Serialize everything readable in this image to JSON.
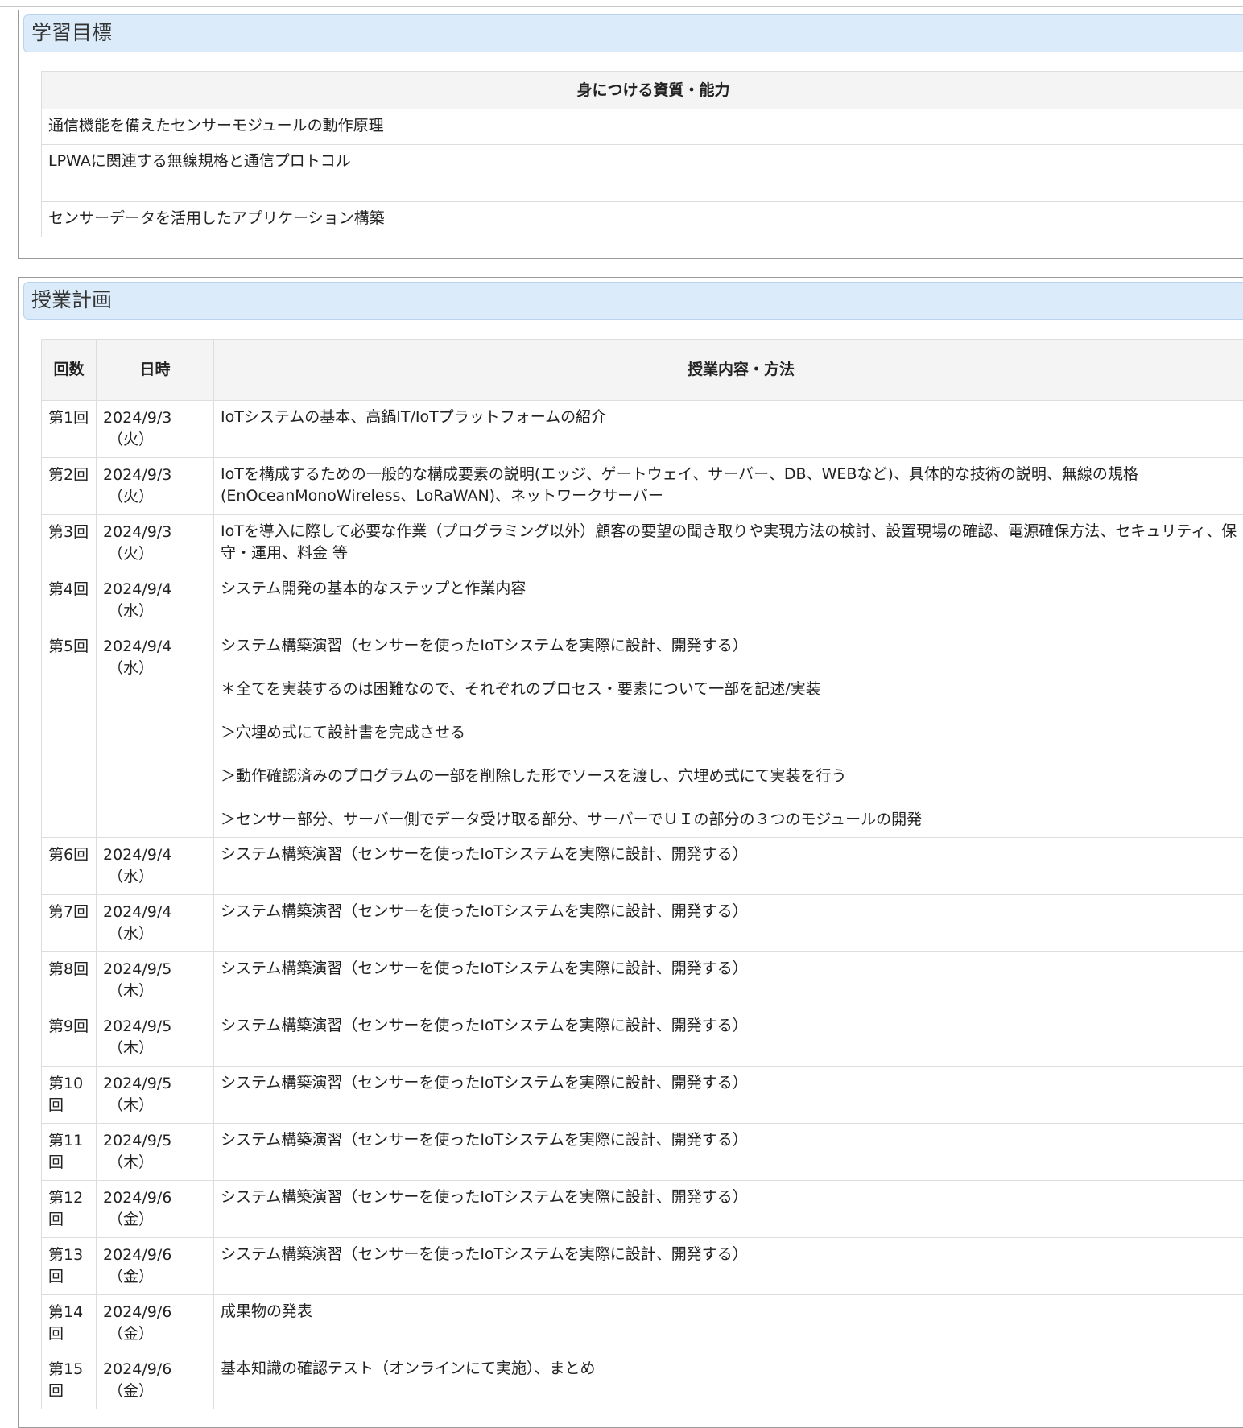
{
  "goals_section": {
    "title": "学習目標",
    "column_header": "身につける資質・能力",
    "items": [
      "通信機能を備えたセンサーモジュールの動作原理",
      "LPWAに関連する無線規格と通信プロトコル",
      "センサーデータを活用したアプリケーション構築"
    ]
  },
  "plan_section": {
    "title": "授業計画",
    "headers": {
      "num": "回数",
      "date": "日時",
      "content": "授業内容・方法"
    },
    "rows": [
      {
        "num": "第1回",
        "date": "2024/9/3",
        "day": "（火）",
        "content": [
          "IoTシステムの基本、高鍋IT/IoTプラットフォームの紹介"
        ]
      },
      {
        "num": "第2回",
        "date": "2024/9/3",
        "day": "（火）",
        "content": [
          "IoTを構成するための一般的な構成要素の説明(エッジ、ゲートウェイ、サーバー、DB、WEBなど)、具体的な技術の説明、無線の規格(EnOceanMonoWireless、LoRaWAN)、ネットワークサーバー"
        ]
      },
      {
        "num": "第3回",
        "date": "2024/9/3",
        "day": "（火）",
        "content": [
          "IoTを導入に際して必要な作業（プログラミング以外）顧客の要望の聞き取りや実現方法の検討、設置現場の確認、電源確保方法、セキュリティ、保守・運用、料金 等"
        ]
      },
      {
        "num": "第4回",
        "date": "2024/9/4",
        "day": "（水）",
        "content": [
          "システム開発の基本的なステップと作業内容"
        ]
      },
      {
        "num": "第5回",
        "date": "2024/9/4",
        "day": "（水）",
        "content": [
          "システム構築演習（センサーを使ったIoTシステムを実際に設計、開発する）",
          "＊全てを実装するのは困難なので、それぞれのプロセス・要素について一部を記述/実装",
          "＞穴埋め式にて設計書を完成させる",
          "＞動作確認済みのプログラムの一部を削除した形でソースを渡し、穴埋め式にて実装を行う",
          "＞センサー部分、サーバー側でデータ受け取る部分、サーバーでＵＩの部分の３つのモジュールの開発"
        ]
      },
      {
        "num": "第6回",
        "date": "2024/9/4",
        "day": "（水）",
        "content": [
          "システム構築演習（センサーを使ったIoTシステムを実際に設計、開発する）"
        ]
      },
      {
        "num": "第7回",
        "date": "2024/9/4",
        "day": "（水）",
        "content": [
          "システム構築演習（センサーを使ったIoTシステムを実際に設計、開発する）"
        ]
      },
      {
        "num": "第8回",
        "date": "2024/9/5",
        "day": "（木）",
        "content": [
          "システム構築演習（センサーを使ったIoTシステムを実際に設計、開発する）"
        ]
      },
      {
        "num": "第9回",
        "date": "2024/9/5",
        "day": "（木）",
        "content": [
          "システム構築演習（センサーを使ったIoTシステムを実際に設計、開発する）"
        ]
      },
      {
        "num": "第10回",
        "date": "2024/9/5",
        "day": "（木）",
        "content": [
          "システム構築演習（センサーを使ったIoTシステムを実際に設計、開発する）"
        ]
      },
      {
        "num": "第11回",
        "date": "2024/9/5",
        "day": "（木）",
        "content": [
          "システム構築演習（センサーを使ったIoTシステムを実際に設計、開発する）"
        ]
      },
      {
        "num": "第12回",
        "date": "2024/9/6",
        "day": "（金）",
        "content": [
          "システム構築演習（センサーを使ったIoTシステムを実際に設計、開発する）"
        ]
      },
      {
        "num": "第13回",
        "date": "2024/9/6",
        "day": "（金）",
        "content": [
          "システム構築演習（センサーを使ったIoTシステムを実際に設計、開発する）"
        ]
      },
      {
        "num": "第14回",
        "date": "2024/9/6",
        "day": "（金）",
        "content": [
          "成果物の発表"
        ]
      },
      {
        "num": "第15回",
        "date": "2024/9/6",
        "day": "（金）",
        "content": [
          "基本知識の確認テスト（オンラインにて実施）、まとめ"
        ]
      }
    ]
  }
}
